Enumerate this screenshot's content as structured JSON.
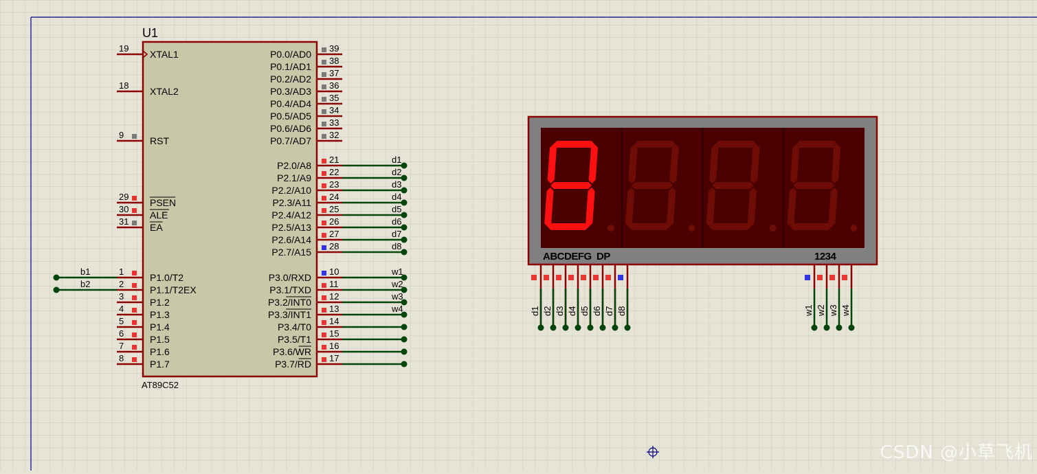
{
  "watermark": "CSDN @小草飞机",
  "mcu": {
    "ref": "U1",
    "part": "AT89C52",
    "left_pins": [
      {
        "num": "19",
        "name": "XTAL1",
        "clock": true
      },
      {
        "num": "18",
        "name": "XTAL2"
      },
      {
        "num": "9",
        "name": "RST"
      },
      {
        "num": "29",
        "name": "PSEN",
        "bar": true
      },
      {
        "num": "30",
        "name": "ALE",
        "bar": true
      },
      {
        "num": "31",
        "name": "EA",
        "bar": true
      },
      {
        "num": "1",
        "name": "P1.0/T2",
        "net": "b1"
      },
      {
        "num": "2",
        "name": "P1.1/T2EX",
        "net": "b2"
      },
      {
        "num": "3",
        "name": "P1.2"
      },
      {
        "num": "4",
        "name": "P1.3"
      },
      {
        "num": "5",
        "name": "P1.4"
      },
      {
        "num": "6",
        "name": "P1.5"
      },
      {
        "num": "7",
        "name": "P1.6"
      },
      {
        "num": "8",
        "name": "P1.7"
      }
    ],
    "right_pins": [
      {
        "num": "39",
        "name": "P0.0/AD0"
      },
      {
        "num": "38",
        "name": "P0.1/AD1"
      },
      {
        "num": "37",
        "name": "P0.2/AD2"
      },
      {
        "num": "36",
        "name": "P0.3/AD3"
      },
      {
        "num": "35",
        "name": "P0.4/AD4"
      },
      {
        "num": "34",
        "name": "P0.5/AD5"
      },
      {
        "num": "33",
        "name": "P0.6/AD6"
      },
      {
        "num": "32",
        "name": "P0.7/AD7"
      },
      {
        "num": "21",
        "name": "P2.0/A8",
        "net": "d1"
      },
      {
        "num": "22",
        "name": "P2.1/A9",
        "net": "d2"
      },
      {
        "num": "23",
        "name": "P2.2/A10",
        "net": "d3"
      },
      {
        "num": "24",
        "name": "P2.3/A11",
        "net": "d4"
      },
      {
        "num": "25",
        "name": "P2.4/A12",
        "net": "d5"
      },
      {
        "num": "26",
        "name": "P2.5/A13",
        "net": "d6"
      },
      {
        "num": "27",
        "name": "P2.6/A14",
        "net": "d7"
      },
      {
        "num": "28",
        "name": "P2.7/A15",
        "net": "d8"
      },
      {
        "num": "10",
        "name": "P3.0/RXD",
        "net": "w1"
      },
      {
        "num": "11",
        "name": "P3.1/TXD",
        "net": "w2"
      },
      {
        "num": "12",
        "name": "P3.2/INT0",
        "net": "w3",
        "barpart": "INT0"
      },
      {
        "num": "13",
        "name": "P3.3/INT1",
        "net": "w4",
        "barpart": "INT1"
      },
      {
        "num": "14",
        "name": "P3.4/T0",
        "dot": true
      },
      {
        "num": "15",
        "name": "P3.5/T1",
        "dot": true
      },
      {
        "num": "16",
        "name": "P3.6/WR",
        "dot": true,
        "barpart": "WR"
      },
      {
        "num": "17",
        "name": "P3.7/RD",
        "dot": true,
        "barpart": "RD"
      }
    ]
  },
  "display": {
    "segment_label": "ABCDEFG  DP",
    "digit_label": "1234",
    "seg_nets": [
      "d1",
      "d2",
      "d3",
      "d4",
      "d5",
      "d6",
      "d7",
      "d8"
    ],
    "digit_nets": [
      "w1",
      "w2",
      "w3",
      "w4"
    ],
    "digits_lit": [
      true,
      false,
      false,
      false
    ],
    "colors": {
      "lit": "#ff1010",
      "unlit": "#6e0c06",
      "bg": "#4a0000",
      "frame": "#808080",
      "border": "#8b0000"
    }
  },
  "colors": {
    "pin": "#8b0000",
    "wire": "#00450a",
    "body": "#c8c8a8",
    "grid": "#c9c8b8",
    "pin_red": "#ee3333",
    "pin_blue": "#3333ee",
    "pin_grey": "#7a7a7a",
    "sheet": "#00008b"
  }
}
